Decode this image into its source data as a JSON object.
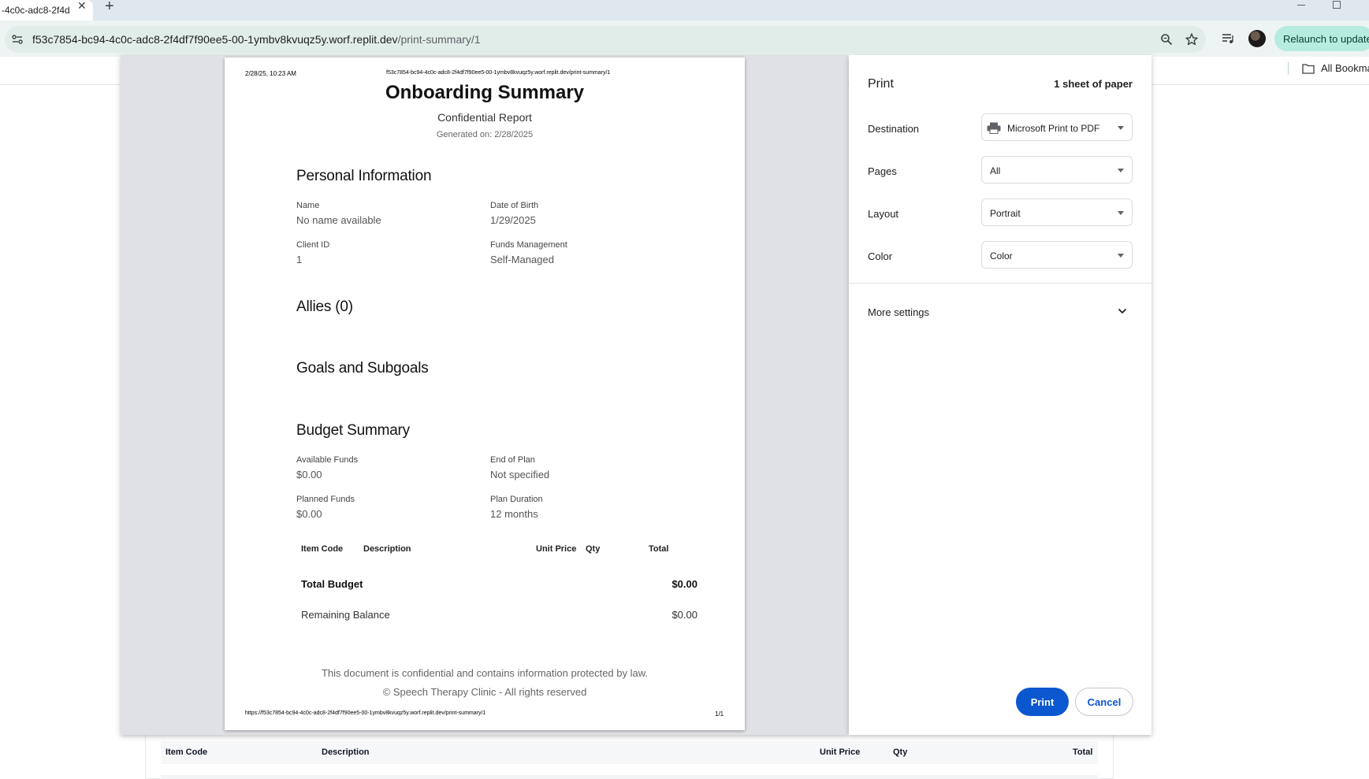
{
  "browser": {
    "tab_title": "-4c0c-adc8-2f4d",
    "tab_close": "✕",
    "new_tab": "+",
    "url_host": "f53c7854-bc94-4c0c-adc8-2f4df7f90ee5-00-1ymbv8kvuqz5y.worf.replit.dev",
    "url_path": "/print-summary/1",
    "relaunch_label": "Relaunch to update",
    "bookmarks_label": "All Bookma"
  },
  "print_page": {
    "header_date": "2/28/25, 10:23 AM",
    "header_url": "f53c7854-bc94-4c0c-adc8-2f4df7f90ee5-00-1ymbv8kvuqz5y.worf.replit.dev/print-summary/1",
    "footer_url": "https://f53c7854-bc94-4c0c-adc8-2f4df7f90ee5-00-1ymbv8kvuqz5y.worf.replit.dev/print-summary/1",
    "footer_page": "1/1"
  },
  "document": {
    "title": "Onboarding Summary",
    "subtitle": "Confidential Report",
    "generated": "Generated on: 2/28/2025",
    "personal": {
      "heading": "Personal Information",
      "name_label": "Name",
      "name_value": "No name available",
      "dob_label": "Date of Birth",
      "dob_value": "1/29/2025",
      "client_label": "Client ID",
      "client_value": "1",
      "funds_label": "Funds Management",
      "funds_value": "Self-Managed"
    },
    "allies_heading": "Allies (0)",
    "goals_heading": "Goals and Subgoals",
    "budget": {
      "heading": "Budget Summary",
      "available_label": "Available Funds",
      "available_value": "$0.00",
      "end_label": "End of Plan",
      "end_value": "Not specified",
      "planned_label": "Planned Funds",
      "planned_value": "$0.00",
      "duration_label": "Plan Duration",
      "duration_value": "12 months",
      "columns": [
        "Item Code",
        "Description",
        "Unit Price",
        "Qty",
        "Total"
      ],
      "total_label": "Total Budget",
      "total_value": "$0.00",
      "remaining_label": "Remaining Balance",
      "remaining_value": "$0.00"
    },
    "footer_line1": "This document is confidential and contains information protected by law.",
    "footer_line2": "© Speech Therapy Clinic - All rights reserved"
  },
  "print_settings": {
    "title": "Print",
    "sheets": "1 sheet of paper",
    "destination_label": "Destination",
    "destination_value": "Microsoft Print to PDF",
    "pages_label": "Pages",
    "pages_value": "All",
    "layout_label": "Layout",
    "layout_value": "Portrait",
    "color_label": "Color",
    "color_value": "Color",
    "more_settings": "More settings",
    "print_button": "Print",
    "cancel_button": "Cancel"
  },
  "underlying_table": {
    "columns": [
      "Item Code",
      "Description",
      "Unit Price",
      "Qty",
      "Total"
    ]
  }
}
